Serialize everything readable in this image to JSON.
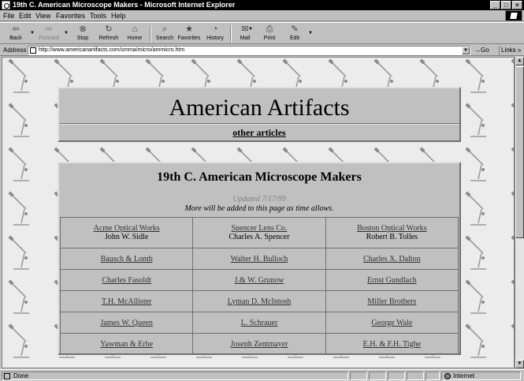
{
  "window": {
    "title": "19th C. American Microscope Makers - Microsoft Internet Explorer",
    "min_glyph": "_",
    "max_glyph": "□",
    "close_glyph": "×"
  },
  "menu": [
    "File",
    "Edit",
    "View",
    "Favorites",
    "Tools",
    "Help"
  ],
  "toolbar": {
    "back": "Back",
    "forward": "Forward",
    "stop": "Stop",
    "refresh": "Refresh",
    "home": "Home",
    "search": "Search",
    "favorites": "Favorites",
    "history": "History",
    "mail": "Mail",
    "print": "Print",
    "edit": "Edit"
  },
  "address": {
    "label": "Address",
    "url": "http://www.americanartifacts.com/smma/micro/ammicro.htm",
    "go": "Go",
    "links": "Links"
  },
  "page": {
    "site_title": "American Artifacts",
    "other_articles": "other articles",
    "heading": "19th C. American Microscope Makers",
    "updated": "Updated 7/17/99",
    "note": "More will be added to this page as time allows.",
    "makers_first_row": [
      {
        "company": "Acme Optical Works",
        "person": "John W. Sidle"
      },
      {
        "company": "Spencer Lens Co.",
        "person": "Charles A. Spencer"
      },
      {
        "company": "Boston Optical Works",
        "person": "Robert B. Tolles"
      }
    ],
    "makers_rows": [
      [
        "Bausch & Lomb",
        "Walter H. Bulloch",
        "Charles X. Dalton"
      ],
      [
        "Charles Fasoldt",
        "J.& W. Grunow",
        "Ernst Gundlach"
      ],
      [
        "T.H. McAllister",
        "Lyman D. McIntosh",
        "Miller Brothers"
      ],
      [
        "James W. Queen",
        "L. Schrauer",
        "George Wale"
      ],
      [
        "Yawman & Erbe",
        "Joseph Zentmayer",
        "E.H. & F.H. Tighe"
      ]
    ]
  },
  "status": {
    "text": "Done",
    "zone": "Internet"
  },
  "colors": {
    "title_bar": "#000000",
    "chrome": "#c0c0c0",
    "panel": "#c0c0c0"
  }
}
